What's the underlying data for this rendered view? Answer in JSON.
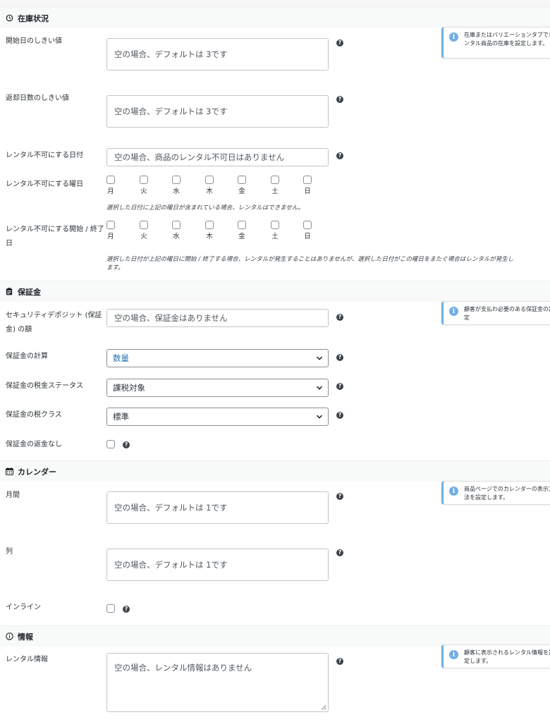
{
  "sections": {
    "inventory": {
      "title": "在庫状況",
      "icon": "history-icon"
    },
    "deposit": {
      "title": "保証金",
      "icon": "clipboard-icon"
    },
    "calendar": {
      "title": "カレンダー",
      "icon": "calendar-icon"
    },
    "info": {
      "title": "情報",
      "icon": "info-circle-icon"
    }
  },
  "inventory": {
    "start_threshold": {
      "label": "開始日のしきい値",
      "placeholder": "空の場合、デフォルトは 3です"
    },
    "return_threshold": {
      "label": "返却日数のしきい値",
      "placeholder": "空の場合、デフォルトは 3です"
    },
    "unavailable_dates": {
      "label": "レンタル不可にする日付",
      "placeholder": "空の場合、商品のレンタル不可日はありません"
    },
    "unavailable_weekdays": {
      "label": "レンタル不可にする曜日",
      "description": "選択した日付に上記の曜日が含まれている場合、レンタルはできません。"
    },
    "unavailable_start_end": {
      "label_line1": "レンタル不可にする開始 / 終了",
      "label_line2": "日",
      "description_line1": "選択した日付が上記の曜日に開始 / 終了する場合、レンタルが発生することはありませんが、選択した日付がこの曜日をまたぐ場合はレンタルが発生し",
      "description_line2": "ます。"
    },
    "weekdays": [
      "月",
      "火",
      "水",
      "木",
      "金",
      "土",
      "日"
    ],
    "notice": "在庫またはバリエーションタブでレンタル商品の在庫を設定します。"
  },
  "deposit": {
    "amount": {
      "label_line1": "セキュリティデポジット (保証",
      "label_line2": "金) の額",
      "placeholder": "空の場合、保証金はありません"
    },
    "calculation": {
      "label": "保証金の計算",
      "value": "数量"
    },
    "tax_status": {
      "label": "保証金の税金ステータス",
      "value": "課税対象"
    },
    "tax_class": {
      "label": "保証金の税クラス",
      "value": "標準"
    },
    "no_refund": {
      "label": "保証金の返金なし"
    },
    "notice": "顧客が支払わ必要のある保証金の設定"
  },
  "calendar": {
    "months": {
      "label": "月間",
      "placeholder": "空の場合、デフォルトは 1です"
    },
    "columns": {
      "label": "列",
      "placeholder": "空の場合、デフォルトは 1です"
    },
    "inline": {
      "label": "インライン"
    },
    "notice": "商品ページでのカレンダーの表示方法を設定します。"
  },
  "info": {
    "rental_info": {
      "label": "レンタル情報",
      "placeholder": "空の場合、レンタル情報はありません"
    },
    "notice": "顧客に表示されるレンタル情報を設定します。"
  },
  "colors": {
    "notice_accent": "#72aee6",
    "link_blue": "#2271b1"
  }
}
